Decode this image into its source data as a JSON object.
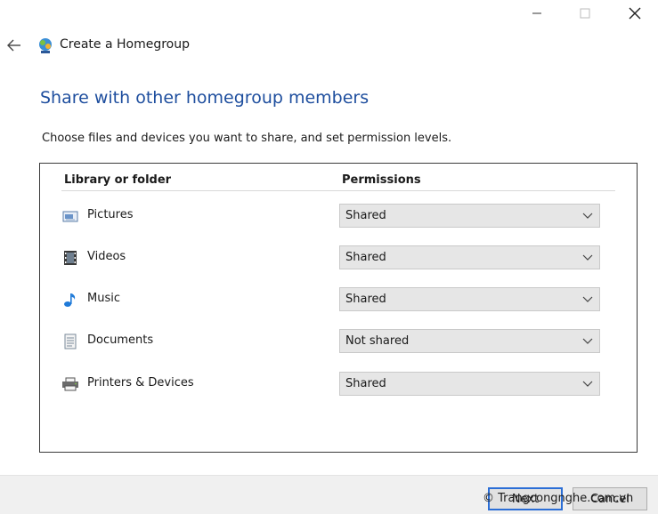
{
  "window": {
    "title": "Create a Homegroup"
  },
  "page": {
    "heading": "Share with other homegroup members",
    "instructions": "Choose files and devices you want to share, and set permission levels."
  },
  "table": {
    "columns": {
      "library": "Library or folder",
      "permissions": "Permissions"
    },
    "rows": [
      {
        "name": "Pictures",
        "permission": "Shared",
        "icon": "pictures-icon"
      },
      {
        "name": "Videos",
        "permission": "Shared",
        "icon": "videos-icon"
      },
      {
        "name": "Music",
        "permission": "Shared",
        "icon": "music-icon"
      },
      {
        "name": "Documents",
        "permission": "Not shared",
        "icon": "documents-icon"
      },
      {
        "name": "Printers & Devices",
        "permission": "Shared",
        "icon": "printer-icon"
      }
    ]
  },
  "footer": {
    "next_label": "Next",
    "cancel_label": "Cancel",
    "watermark": "© Trangcongnghe.com.vn"
  },
  "colors": {
    "heading": "#1e4e9e",
    "accent": "#2b6ed6"
  }
}
